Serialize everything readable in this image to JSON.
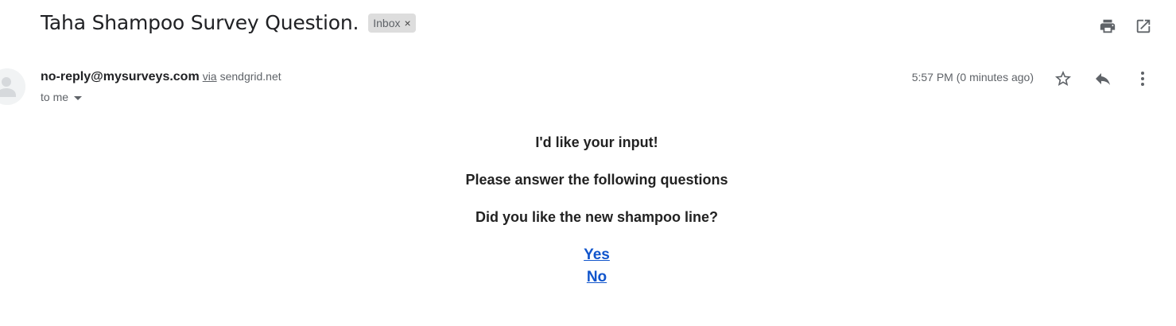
{
  "email": {
    "subject": "Taha Shampoo Survey Question.",
    "label": "Inbox",
    "label_remove": "×",
    "sender_email": "no-reply@mysurveys.com",
    "via_text": "via",
    "via_domain": "sendgrid.net",
    "recipient": "to me",
    "timestamp": "5:57 PM (0 minutes ago)"
  },
  "body": {
    "line1": "I'd like your input!",
    "line2": "Please answer the following questions",
    "question": "Did you like the new shampoo line?",
    "options": [
      "Yes",
      "No"
    ]
  },
  "icons": {
    "print": "print-icon",
    "open_new_window": "open-in-new-window-icon",
    "star": "star-icon",
    "reply": "reply-icon",
    "more": "more-vertical-icon",
    "avatar": "default-avatar-icon"
  },
  "colors": {
    "link": "#1155cc",
    "label_bg": "#dddddd",
    "secondary_text": "#5f6368"
  }
}
